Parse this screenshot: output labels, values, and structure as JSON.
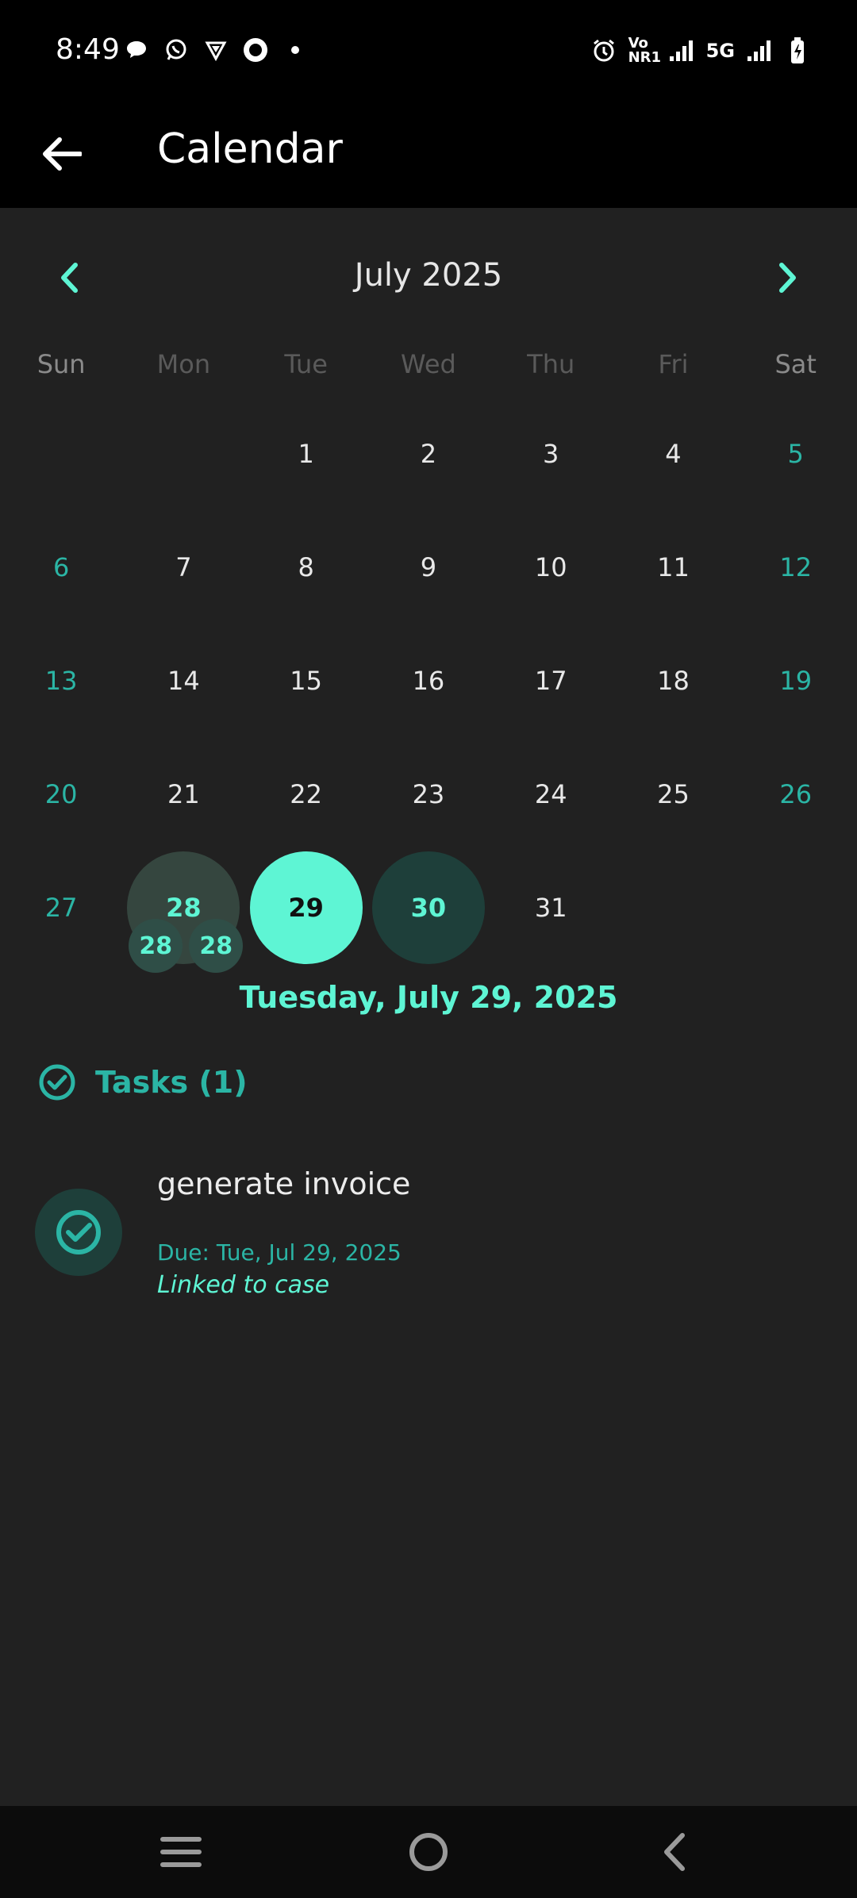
{
  "status_bar": {
    "time": "8:49",
    "left_icons": [
      "chat-bubble-icon",
      "whatsapp-icon",
      "vpn-icon",
      "record-icon",
      "dot-icon"
    ],
    "right_icons": [
      "alarm-icon",
      "volte-icon",
      "signal-icon",
      "signal-icon",
      "battery-icon"
    ],
    "network_label": "5G",
    "volte_label": "Vo NR1"
  },
  "app_bar": {
    "title": "Calendar"
  },
  "calendar": {
    "month_label": "July 2025",
    "weekdays": [
      "Sun",
      "Mon",
      "Tue",
      "Wed",
      "Thu",
      "Fri",
      "Sat"
    ],
    "weeks": [
      [
        "",
        "",
        "1",
        "2",
        "3",
        "4",
        "5"
      ],
      [
        "6",
        "7",
        "8",
        "9",
        "10",
        "11",
        "12"
      ],
      [
        "13",
        "14",
        "15",
        "16",
        "17",
        "18",
        "19"
      ],
      [
        "20",
        "21",
        "22",
        "23",
        "24",
        "25",
        "26"
      ],
      [
        "27",
        "28",
        "29",
        "30",
        "31",
        "",
        ""
      ]
    ],
    "event_day_mini_labels": [
      "28",
      "28"
    ],
    "selected_day": "29",
    "today_day": "30",
    "event_day": "28"
  },
  "selected_date_label": "Tuesday, July 29, 2025",
  "tasks": {
    "header": "Tasks (1)",
    "items": [
      {
        "title": "generate invoice",
        "due": "Due: Tue, Jul 29, 2025",
        "link": "Linked to case"
      }
    ]
  },
  "colors": {
    "accent": "#5ef5d4",
    "accent_dark": "#2bb5a5",
    "background": "#212121",
    "bar": "#000000"
  }
}
